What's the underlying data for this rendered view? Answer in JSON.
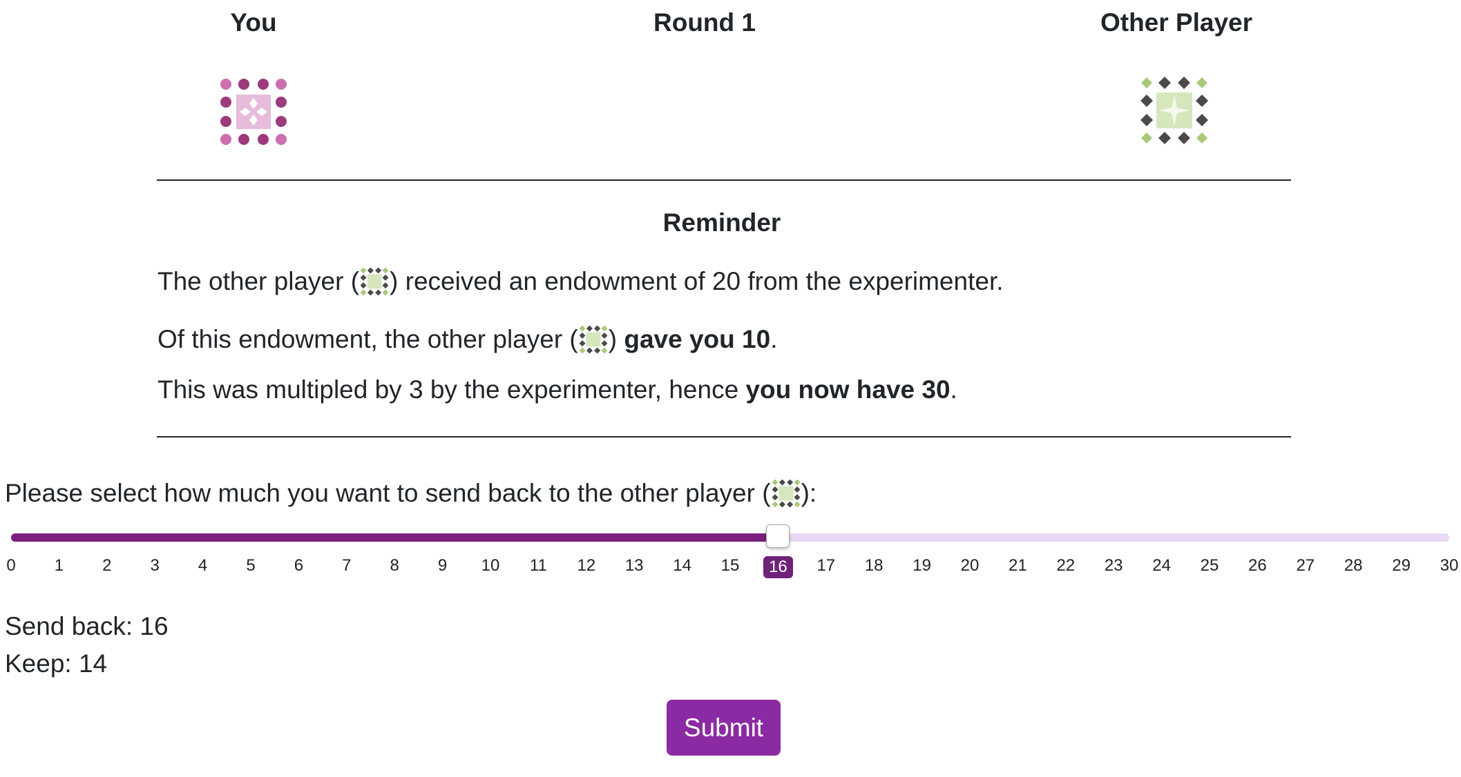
{
  "header": {
    "you_label": "You",
    "round_label": "Round 1",
    "other_label": "Other Player"
  },
  "avatars": {
    "you": "pink-tiled-quilt-icon",
    "other": "green-gray-quilt-icon"
  },
  "reminder": {
    "title": "Reminder",
    "line1_pre": "The other player (",
    "line1_post": ") received an endowment of 20 from the experimenter.",
    "line2_pre": "Of this endowment, the other player (",
    "line2_mid": ") ",
    "line2_bold": "gave you 10",
    "line2_end": ".",
    "line3_pre": "This was multipled by 3 by the experimenter, hence ",
    "line3_bold": "you now have 30",
    "line3_end": "."
  },
  "prompt": {
    "pre": "Please select how much you want to send back to the other player (",
    "post": "):"
  },
  "slider": {
    "min": 0,
    "max": 30,
    "value": 16,
    "ticks": [
      "0",
      "1",
      "2",
      "3",
      "4",
      "5",
      "6",
      "7",
      "8",
      "9",
      "10",
      "11",
      "12",
      "13",
      "14",
      "15",
      "16",
      "17",
      "18",
      "19",
      "20",
      "21",
      "22",
      "23",
      "24",
      "25",
      "26",
      "27",
      "28",
      "29",
      "30"
    ]
  },
  "summary": {
    "send_back": "Send back: 16",
    "keep": "Keep: 14"
  },
  "submit_label": "Submit",
  "colors": {
    "accent": "#8b2ba3",
    "slider_fill": "#7a1f7e",
    "slider_track": "#ead8f3",
    "pink": "#cc6fae",
    "dark_pink": "#9c3a7c",
    "green": "#a9c97a",
    "dark_gray": "#4a4a4a"
  }
}
